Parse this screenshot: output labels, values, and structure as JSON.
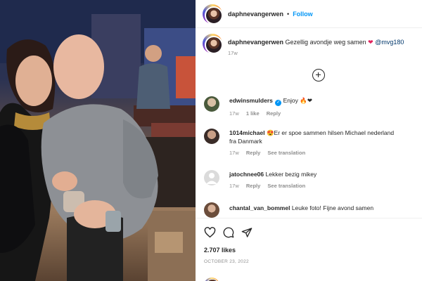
{
  "post": {
    "username": "daphnevangerwen",
    "separator": "•",
    "follow_label": "Follow"
  },
  "caption": {
    "username": "daphnevangerwen",
    "text": "Gezellig avondje weg samen",
    "emoji": "❤",
    "mention": "@mvg180",
    "age": "17w"
  },
  "comments": [
    {
      "username": "edwinsmulders",
      "verified": true,
      "text": "Enjoy 🔥❤",
      "age": "17w",
      "likes": "1 like",
      "reply": "Reply",
      "see_translation": ""
    },
    {
      "username": "1014michael",
      "verified": false,
      "text": "😍Er er spoe sammen hilsen Michael nederland fra Danmark",
      "line1": "😍Er er spoe sammen hilsen Michael nederland",
      "line2": "fra Danmark",
      "age": "17w",
      "likes": "",
      "reply": "Reply",
      "see_translation": "See translation"
    },
    {
      "username": "jatochnee06",
      "verified": false,
      "text": "Lekker bezig mikey",
      "age": "17w",
      "likes": "",
      "reply": "Reply",
      "see_translation": "See translation"
    },
    {
      "username": "chantal_van_bommel",
      "verified": false,
      "text": "Leuke foto! Fijne avond samen",
      "age": "",
      "likes": "",
      "reply": "",
      "see_translation": ""
    }
  ],
  "actions": {
    "likes_count": "2.707 likes",
    "date": "OCTOBER 23, 2022"
  },
  "icons": {
    "like": "heart-icon",
    "comment": "comment-icon",
    "share": "share-icon",
    "add": "plus-circle-icon"
  },
  "colors": {
    "follow": "#0095f6",
    "verified": "#0095f6",
    "muted": "#8e8e8e",
    "mention": "#00376b"
  }
}
